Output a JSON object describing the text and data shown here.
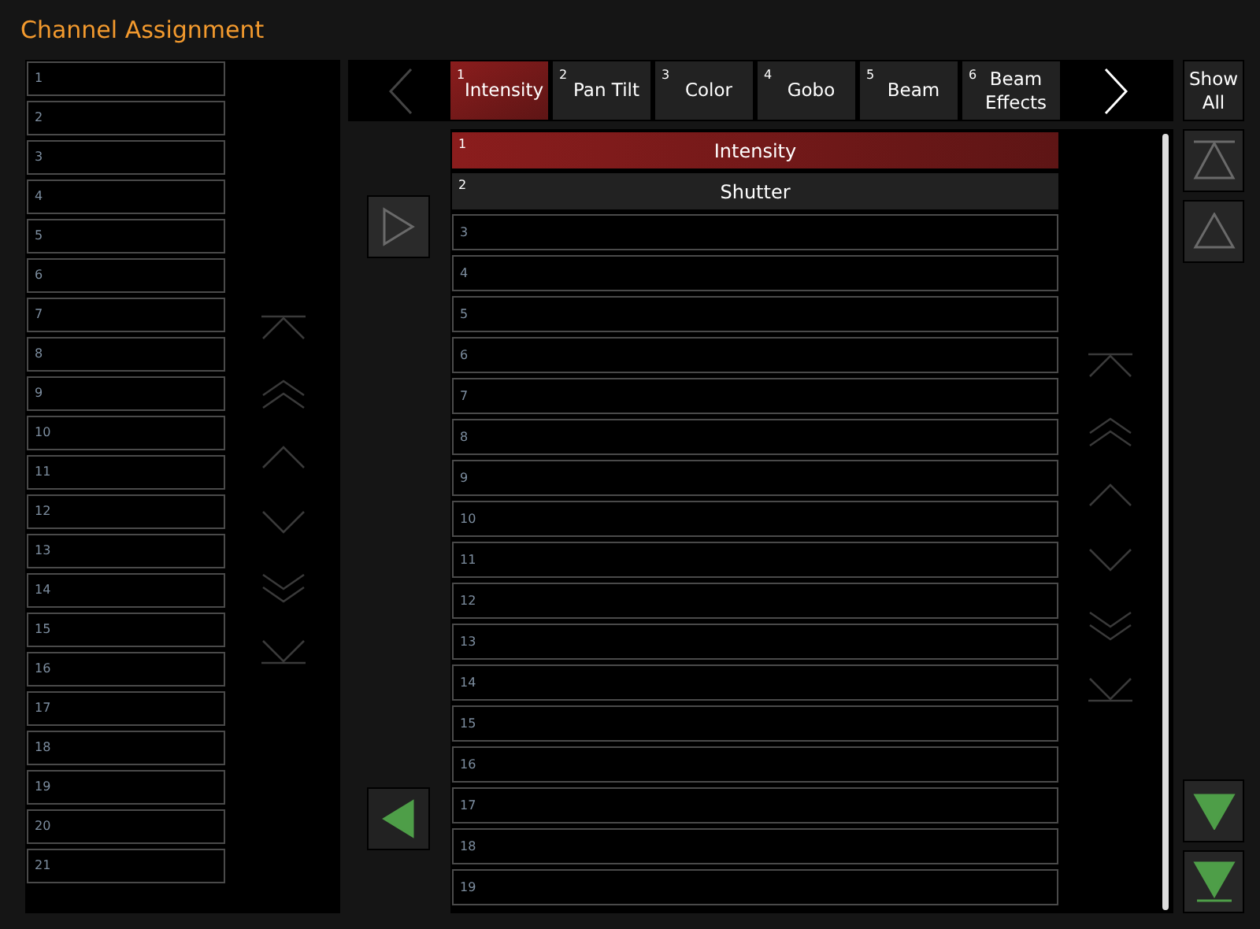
{
  "title": "Channel Assignment",
  "left_slots": [
    "1",
    "2",
    "3",
    "4",
    "5",
    "6",
    "7",
    "8",
    "9",
    "10",
    "11",
    "12",
    "13",
    "14",
    "15",
    "16",
    "17",
    "18",
    "19",
    "20",
    "21"
  ],
  "tab_prev": {
    "disabled": true
  },
  "tabs": [
    {
      "number": "1",
      "label": "Intensity",
      "selected": true
    },
    {
      "number": "2",
      "label": "Pan Tilt",
      "selected": false
    },
    {
      "number": "3",
      "label": "Color",
      "selected": false
    },
    {
      "number": "4",
      "label": "Gobo",
      "selected": false
    },
    {
      "number": "5",
      "label": "Beam",
      "selected": false
    },
    {
      "number": "6",
      "label": "Beam Effects",
      "selected": false
    }
  ],
  "tab_next": {
    "disabled": false
  },
  "show_all": "Show All",
  "add_button": {
    "disabled": true
  },
  "remove_button": {
    "disabled": false
  },
  "rows": [
    {
      "number": "1",
      "label": "Intensity",
      "selected": true
    },
    {
      "number": "2",
      "label": "Shutter",
      "selected": false
    },
    {
      "number": "3",
      "selected": false
    },
    {
      "number": "4",
      "selected": false
    },
    {
      "number": "5",
      "selected": false
    },
    {
      "number": "6",
      "selected": false
    },
    {
      "number": "7",
      "selected": false
    },
    {
      "number": "8",
      "selected": false
    },
    {
      "number": "9",
      "selected": false
    },
    {
      "number": "10",
      "selected": false
    },
    {
      "number": "11",
      "selected": false
    },
    {
      "number": "12",
      "selected": false
    },
    {
      "number": "13",
      "selected": false
    },
    {
      "number": "14",
      "selected": false
    },
    {
      "number": "15",
      "selected": false
    },
    {
      "number": "16",
      "selected": false
    },
    {
      "number": "17",
      "selected": false
    },
    {
      "number": "18",
      "selected": false
    },
    {
      "number": "19",
      "selected": false
    }
  ],
  "move_buttons": [
    {
      "kind": "top",
      "disabled": true
    },
    {
      "kind": "up",
      "disabled": true
    },
    {
      "kind": "down",
      "disabled": false
    },
    {
      "kind": "bottom",
      "disabled": false
    }
  ]
}
